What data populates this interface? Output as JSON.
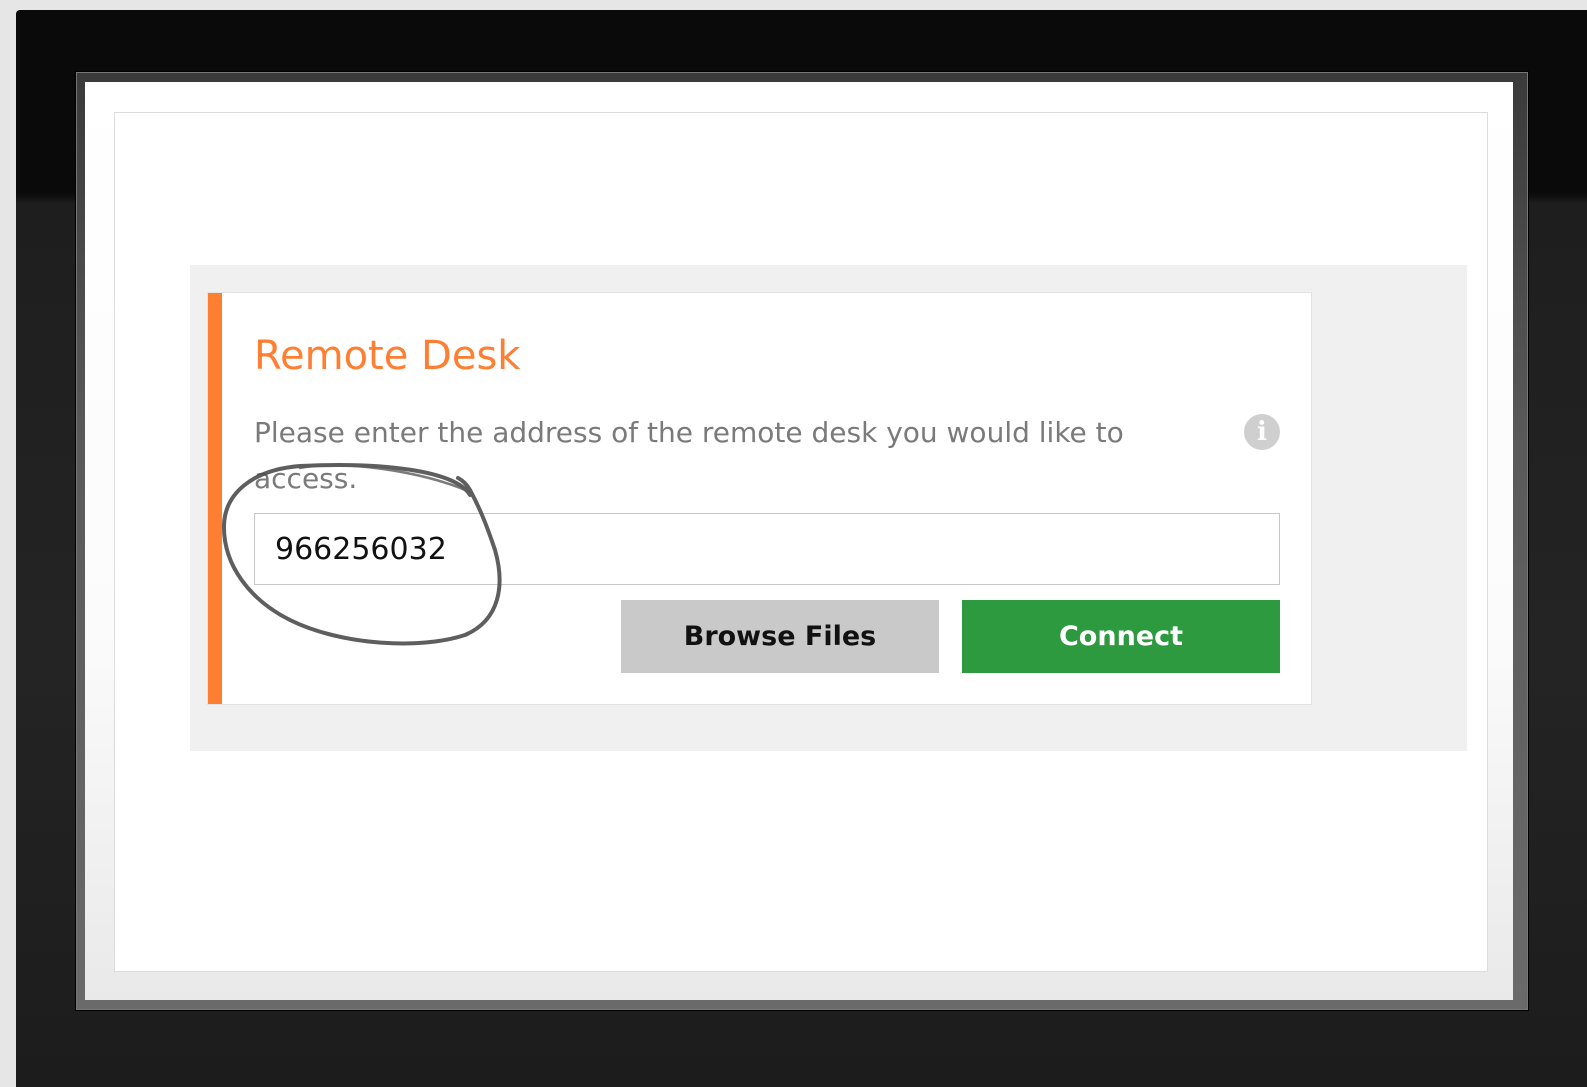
{
  "remote_desk": {
    "title": "Remote Desk",
    "description": "Please enter the address of the remote desk you would like to access.",
    "address_value": "966256032",
    "browse_label": "Browse Files",
    "connect_label": "Connect",
    "info_glyph": "i"
  },
  "colors": {
    "accent": "#ff7f32",
    "connect": "#2e9a3f",
    "browse": "#c9c9c9"
  },
  "icons": {
    "info": "info-icon"
  }
}
